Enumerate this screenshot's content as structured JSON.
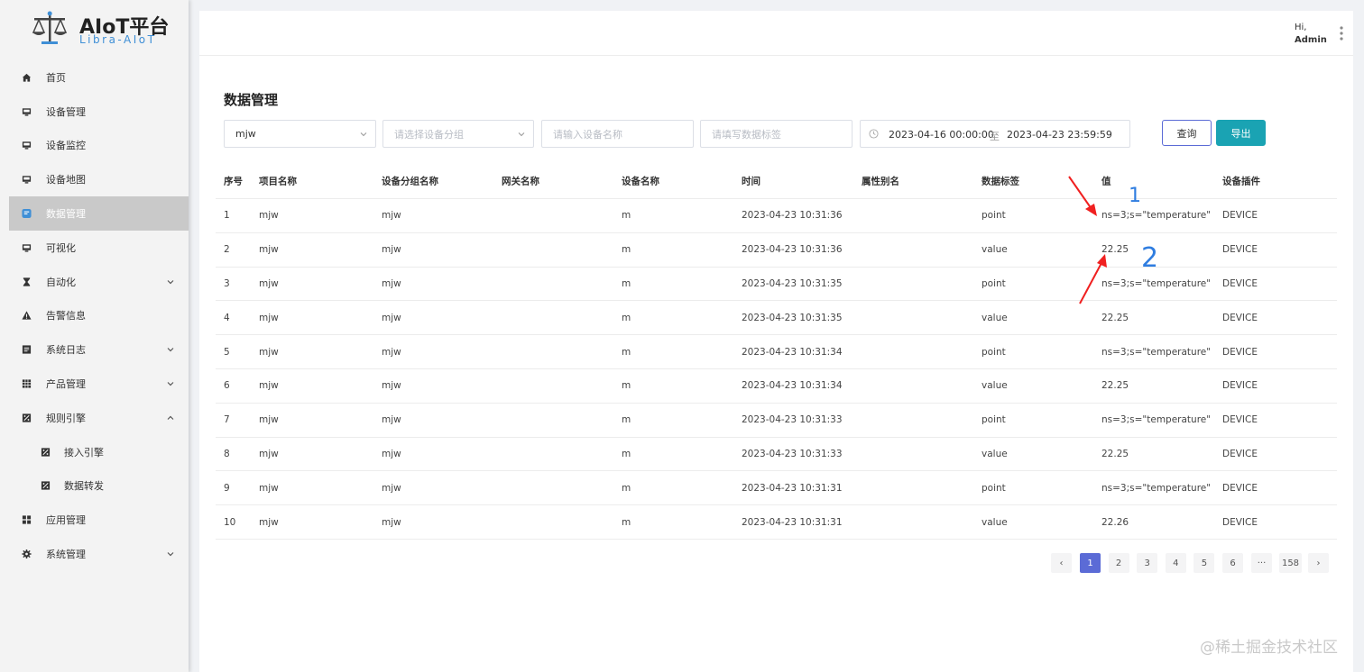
{
  "app": {
    "logo_title": "AIoT平台",
    "logo_subtitle": "Libra-AIoT"
  },
  "sidebar": {
    "items": [
      {
        "label": "首页",
        "icon": "home-icon"
      },
      {
        "label": "设备管理",
        "icon": "monitor-icon"
      },
      {
        "label": "设备监控",
        "icon": "monitor-icon"
      },
      {
        "label": "设备地图",
        "icon": "monitor-icon"
      },
      {
        "label": "数据管理",
        "icon": "chat-icon",
        "active": true
      },
      {
        "label": "可视化",
        "icon": "monitor-icon"
      },
      {
        "label": "自动化",
        "icon": "hourglass-icon",
        "expandable": true
      },
      {
        "label": "告警信息",
        "icon": "warning-icon"
      },
      {
        "label": "系统日志",
        "icon": "log-icon",
        "expandable": true
      },
      {
        "label": "产品管理",
        "icon": "grid-icon",
        "expandable": true
      },
      {
        "label": "规则引擎",
        "icon": "rule-icon",
        "expandable": true,
        "expanded": true
      },
      {
        "label": "接入引擎",
        "icon": "rule-icon",
        "sub": true
      },
      {
        "label": "数据转发",
        "icon": "rule-icon",
        "sub": true
      },
      {
        "label": "应用管理",
        "icon": "apps-icon"
      },
      {
        "label": "系统管理",
        "icon": "gear-icon",
        "expandable": true
      }
    ]
  },
  "header": {
    "greeting": "Hi,",
    "user": "Admin"
  },
  "page": {
    "title": "数据管理"
  },
  "filters": {
    "project_value": "mjw",
    "group_placeholder": "请选择设备分组",
    "device_placeholder": "请输入设备名称",
    "tag_placeholder": "请填写数据标签",
    "date_start": "2023-04-16 00:00:00",
    "date_sep": "至",
    "date_end": "2023-04-23 23:59:59",
    "query_label": "查询",
    "export_label": "导出"
  },
  "table": {
    "headers": [
      "序号",
      "项目名称",
      "设备分组名称",
      "网关名称",
      "设备名称",
      "时间",
      "属性别名",
      "数据标签",
      "值",
      "设备插件"
    ],
    "rows": [
      [
        "1",
        "mjw",
        "mjw",
        "",
        "m",
        "2023-04-23 10:31:36",
        "",
        "point",
        "ns=3;s=\"temperature\"",
        "DEVICE"
      ],
      [
        "2",
        "mjw",
        "mjw",
        "",
        "m",
        "2023-04-23 10:31:36",
        "",
        "value",
        "22.25",
        "DEVICE"
      ],
      [
        "3",
        "mjw",
        "mjw",
        "",
        "m",
        "2023-04-23 10:31:35",
        "",
        "point",
        "ns=3;s=\"temperature\"",
        "DEVICE"
      ],
      [
        "4",
        "mjw",
        "mjw",
        "",
        "m",
        "2023-04-23 10:31:35",
        "",
        "value",
        "22.25",
        "DEVICE"
      ],
      [
        "5",
        "mjw",
        "mjw",
        "",
        "m",
        "2023-04-23 10:31:34",
        "",
        "point",
        "ns=3;s=\"temperature\"",
        "DEVICE"
      ],
      [
        "6",
        "mjw",
        "mjw",
        "",
        "m",
        "2023-04-23 10:31:34",
        "",
        "value",
        "22.25",
        "DEVICE"
      ],
      [
        "7",
        "mjw",
        "mjw",
        "",
        "m",
        "2023-04-23 10:31:33",
        "",
        "point",
        "ns=3;s=\"temperature\"",
        "DEVICE"
      ],
      [
        "8",
        "mjw",
        "mjw",
        "",
        "m",
        "2023-04-23 10:31:33",
        "",
        "value",
        "22.25",
        "DEVICE"
      ],
      [
        "9",
        "mjw",
        "mjw",
        "",
        "m",
        "2023-04-23 10:31:31",
        "",
        "point",
        "ns=3;s=\"temperature\"",
        "DEVICE"
      ],
      [
        "10",
        "mjw",
        "mjw",
        "",
        "m",
        "2023-04-23 10:31:31",
        "",
        "value",
        "22.26",
        "DEVICE"
      ]
    ]
  },
  "pagination": {
    "prev": "‹",
    "pages": [
      "1",
      "2",
      "3",
      "4",
      "5",
      "6"
    ],
    "ellipsis": "···",
    "last": "158",
    "next": "›",
    "current": "1"
  },
  "annotations": {
    "mark1": "1",
    "mark2": "2"
  },
  "watermark": "@稀土掘金技术社区",
  "colors": {
    "accent": "#5b6bd6",
    "export": "#1aa3b3",
    "active_menu": "#c9c9c9",
    "arrow": "#f02020",
    "handwriting": "#2f7de0"
  }
}
